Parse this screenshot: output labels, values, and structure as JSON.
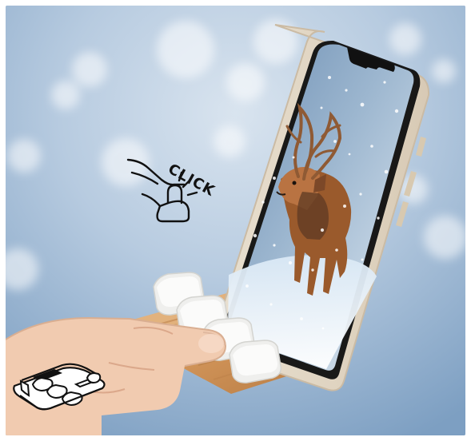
{
  "scene": {
    "background_color": "#b8cce1",
    "bokeh_color": "#ffffff",
    "wood_color": "#d8a36b",
    "phone_frame_color": "#e7dccd",
    "keycap_color": "#f4f4f2",
    "skin_color": "#f0c7a8",
    "icon_name": "hand-click-icon",
    "mini_device_icon_name": "macropad-outline-icon",
    "click_label": "CLICK"
  }
}
